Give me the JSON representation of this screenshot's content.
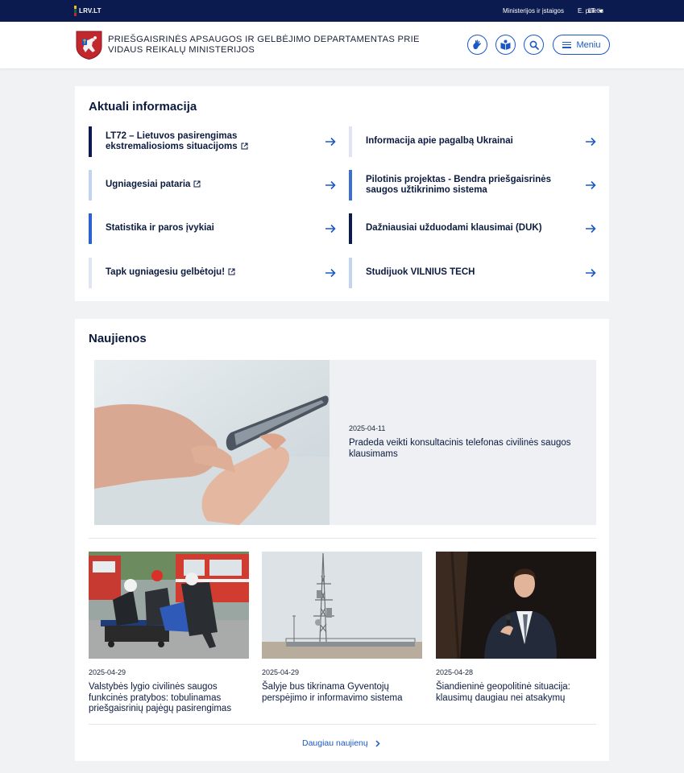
{
  "topbar": {
    "brand": "LRV.LT",
    "links": [
      "Ministerijos ir įstaigos",
      "E. pilietis"
    ],
    "lang": "LT"
  },
  "header": {
    "institution_name": "Priešgaisrinės apsaugos ir gelbėjimo departamentas prie Vidaus reikalų ministerijos",
    "icons": [
      "sign-language-icon",
      "easy-read-icon",
      "search-icon"
    ],
    "menu_label": "Meniu"
  },
  "info": {
    "title": "Aktuali informacija",
    "items": [
      {
        "label": "LT72 – Lietuvos pasirengimas ekstremaliosioms situacijoms",
        "external": true,
        "accent": "#0b1a4f"
      },
      {
        "label": "Informacija apie pagalbą Ukrainai",
        "external": false,
        "accent": "#dfe5f3"
      },
      {
        "label": "Ugniagesiai pataria",
        "external": true,
        "accent": "#c3d4f3"
      },
      {
        "label": "Pilotinis projektas - Bendra priešgaisrinės saugos užtikrinimo sistema",
        "external": false,
        "accent": "#3b6fd4"
      },
      {
        "label": "Statistika ir paros įvykiai",
        "external": false,
        "accent": "#2a63cf"
      },
      {
        "label": "Dažniausiai užduodami klausimai (DUK)",
        "external": false,
        "accent": "#0b1a4f"
      },
      {
        "label": "Tapk ugniagesiu gelbėtoju!",
        "external": true,
        "accent": "#dfe5f3"
      },
      {
        "label": "Studijuok VILNIUS TECH",
        "external": false,
        "accent": "#c3d4f3"
      }
    ]
  },
  "news": {
    "title": "Naujienos",
    "featured": {
      "date": "2025-04-11",
      "title": "Pradeda veikti konsultacinis telefonas civilinės saugos klausimams"
    },
    "items": [
      {
        "date": "2025-04-29",
        "title": "Valstybės lygio civilinės saugos funkcinės pratybos: tobulinamas priešgaisrinių pajėgų pasirengimas"
      },
      {
        "date": "2025-04-29",
        "title": "Šalyje bus tikrinama Gyventojų perspėjimo ir informavimo sistema"
      },
      {
        "date": "2025-04-28",
        "title": "Šiandieninė geopolitinė situacija: klausimų daugiau nei atsakymų"
      }
    ],
    "more_label": "Daugiau naujienų"
  }
}
